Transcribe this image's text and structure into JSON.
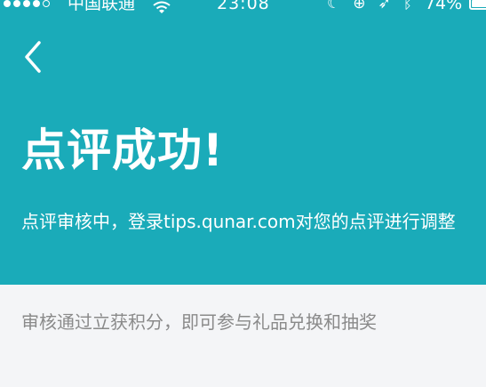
{
  "status_bar": {
    "carrier": "中国联通",
    "time": "23:08",
    "battery_percent": "74%",
    "battery_level": 0.74,
    "icons": [
      "signal-icon",
      "wifi-icon",
      "moon-icon",
      "orientation-lock-icon",
      "location-icon",
      "bluetooth-icon",
      "battery-icon"
    ]
  },
  "header": {
    "back_icon": "chevron-left-icon",
    "title": "点评成功!",
    "message": "点评审核中，登录tips.qunar.com对您的点评进行调整"
  },
  "body": {
    "reward_text": "审核通过立获积分，即可参与礼品兑换和抽奖"
  },
  "colors": {
    "header_bg": "#1aabb9",
    "panel_bg": "#f4f5f7",
    "secondary_text": "#8a8a8a",
    "white": "#ffffff"
  }
}
